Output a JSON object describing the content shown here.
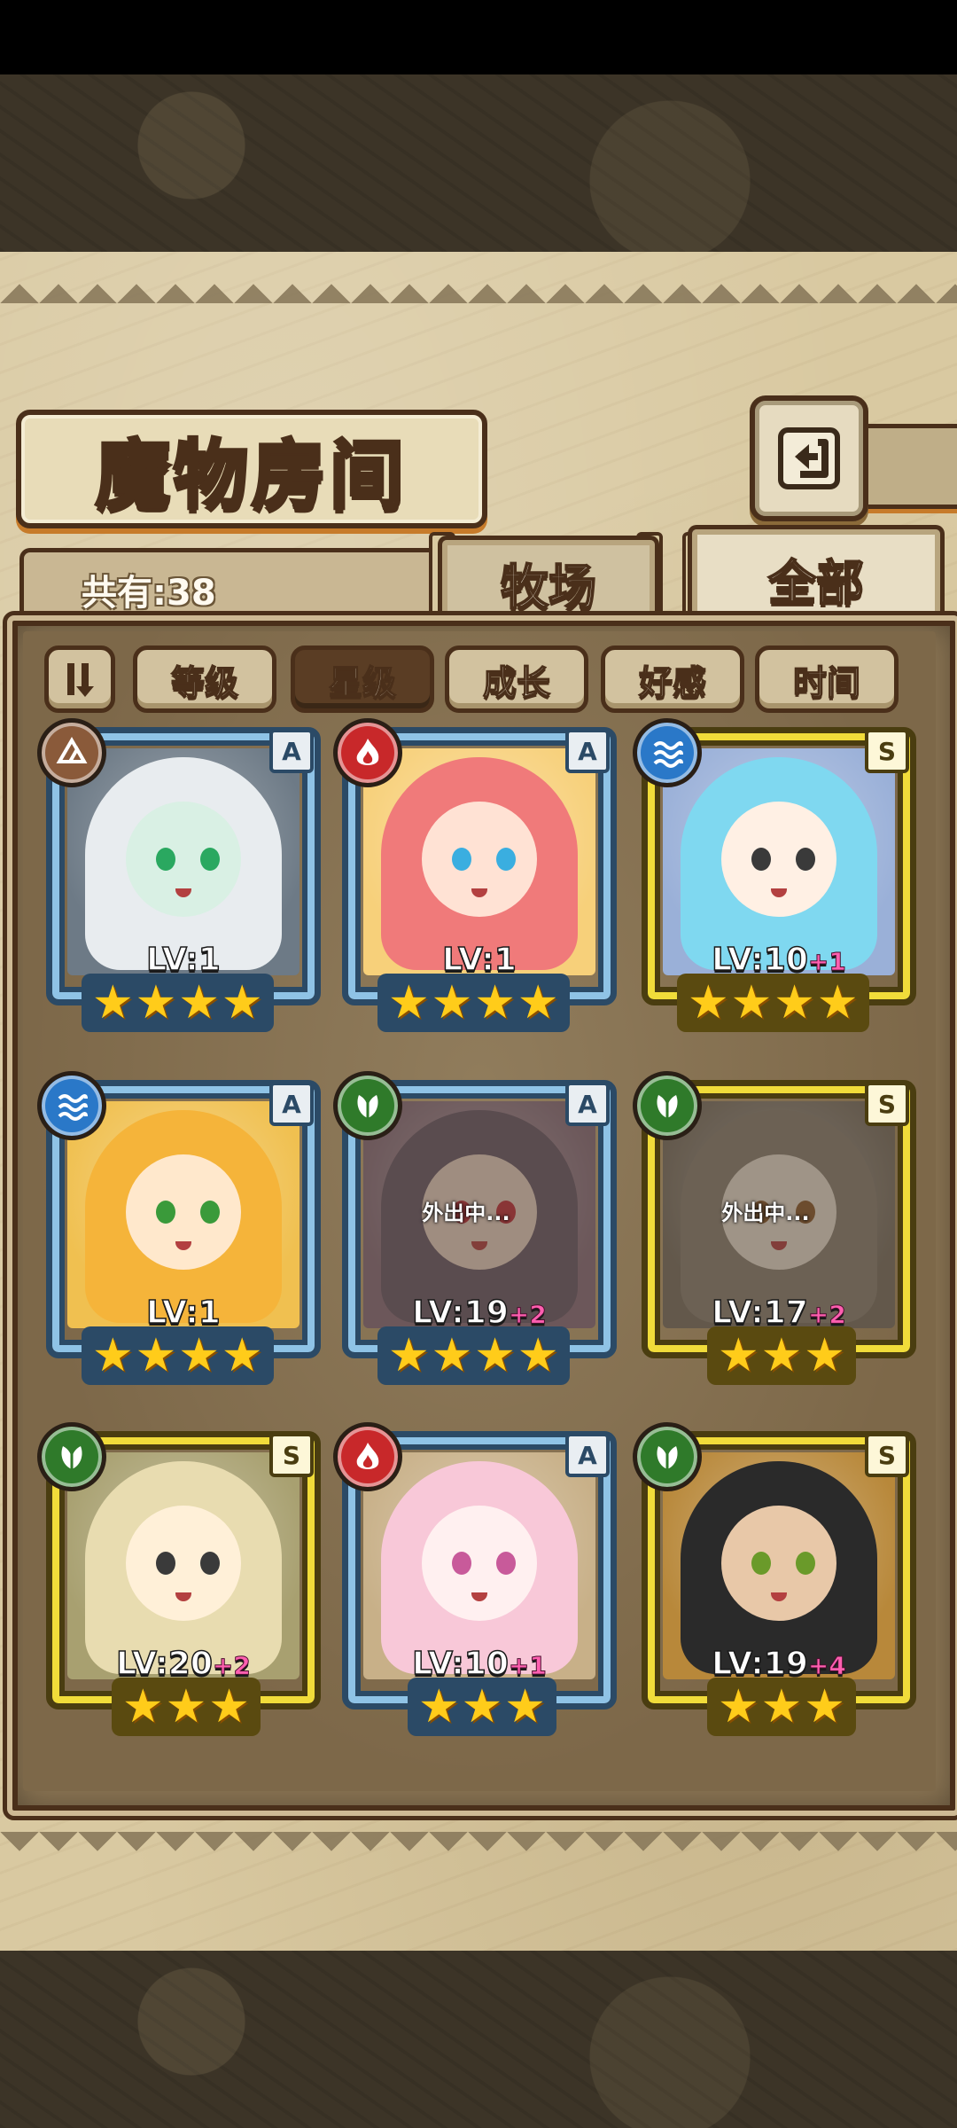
{
  "header": {
    "title": "魔物房间",
    "total_count": "共有:38"
  },
  "tabs": [
    {
      "label": "牧场",
      "active": false
    },
    {
      "label": "全部",
      "active": true
    }
  ],
  "sort_buttons": [
    {
      "label": "等级",
      "active": false
    },
    {
      "label": "星级",
      "active": true
    },
    {
      "label": "成长",
      "active": false
    },
    {
      "label": "好感",
      "active": false
    },
    {
      "label": "时间",
      "active": false
    }
  ],
  "monsters": [
    {
      "element": "earth",
      "rank": "A",
      "level": "LV:1",
      "bonus": "",
      "stars": 4,
      "status": ""
    },
    {
      "element": "fire",
      "rank": "A",
      "level": "LV:1",
      "bonus": "",
      "stars": 4,
      "status": ""
    },
    {
      "element": "water",
      "rank": "S",
      "level": "LV:10",
      "bonus": "+1",
      "stars": 4,
      "status": ""
    },
    {
      "element": "water",
      "rank": "A",
      "level": "LV:1",
      "bonus": "",
      "stars": 4,
      "status": ""
    },
    {
      "element": "wood",
      "rank": "A",
      "level": "LV:19",
      "bonus": "+2",
      "stars": 4,
      "status": "外出中..."
    },
    {
      "element": "wood",
      "rank": "S",
      "level": "LV:17",
      "bonus": "+2",
      "stars": 3,
      "status": "外出中..."
    },
    {
      "element": "wood",
      "rank": "S",
      "level": "LV:20",
      "bonus": "+2",
      "stars": 3,
      "status": ""
    },
    {
      "element": "fire",
      "rank": "A",
      "level": "LV:10",
      "bonus": "+1",
      "stars": 3,
      "status": ""
    },
    {
      "element": "wood",
      "rank": "S",
      "level": "LV:19",
      "bonus": "+4",
      "stars": 3,
      "status": ""
    }
  ],
  "star_glyph": "★",
  "colors": {
    "earth": "#8a5a3a",
    "fire": "#c8282a",
    "water": "#2a78c8",
    "wood": "#2f7a2a",
    "rank_a_frame": "#8fc3e6",
    "rank_s_frame": "#f1dc3a"
  }
}
